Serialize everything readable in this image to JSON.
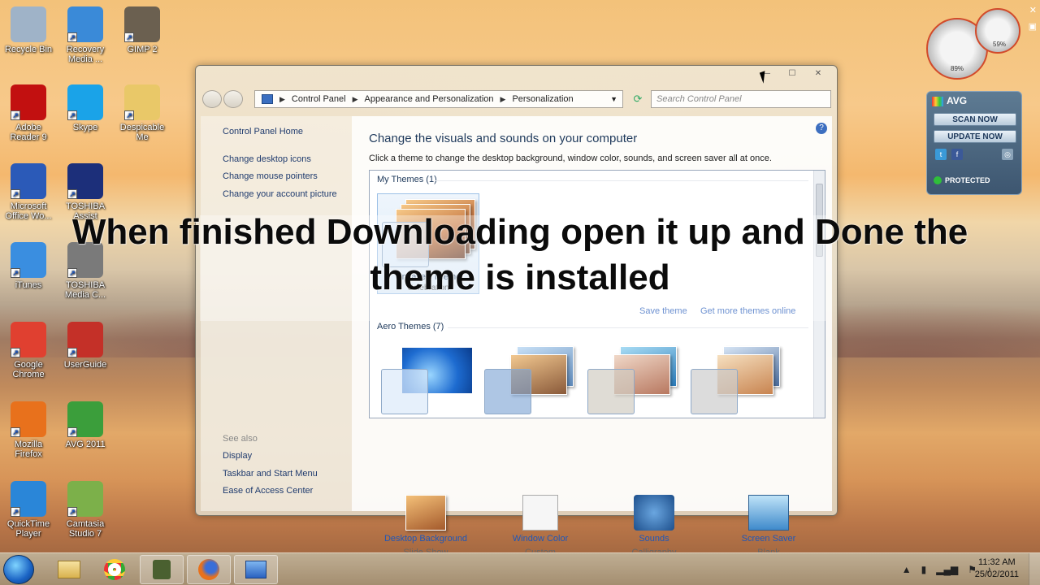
{
  "desktop": {
    "icons": [
      {
        "label": "Recycle Bin",
        "icon": "recycle-bin-icon",
        "color": "#9fb3c8"
      },
      {
        "label": "Recovery Media ...",
        "icon": "recovery-media-icon",
        "color": "#3a8ad8"
      },
      {
        "label": "GIMP 2",
        "icon": "gimp-icon",
        "color": "#6b6050"
      },
      {
        "label": "Adobe Reader 9",
        "icon": "adobe-reader-icon",
        "color": "#c21010"
      },
      {
        "label": "Skype",
        "icon": "skype-icon",
        "color": "#1aa3e8"
      },
      {
        "label": "Despicable Me",
        "icon": "folder-icon",
        "color": "#e9c868"
      },
      {
        "label": "Microsoft Office Wo...",
        "icon": "word-icon",
        "color": "#2b5ab8"
      },
      {
        "label": "TOSHIBA Assist",
        "icon": "toshiba-assist-icon",
        "color": "#1c2f7a"
      },
      {
        "label": "iTunes",
        "icon": "itunes-icon",
        "color": "#3a8ee0"
      },
      {
        "label": "TOSHIBA Media C...",
        "icon": "toshiba-media-icon",
        "color": "#7a7a7a"
      },
      {
        "label": "Google Chrome",
        "icon": "chrome-icon",
        "color": "#e04030"
      },
      {
        "label": "UserGuide",
        "icon": "userguide-icon",
        "color": "#c43028"
      },
      {
        "label": "Mozilla Firefox",
        "icon": "firefox-icon",
        "color": "#e8711c"
      },
      {
        "label": "AVG 2011",
        "icon": "avg-icon",
        "color": "#3b9e3b"
      },
      {
        "label": "QuickTime Player",
        "icon": "quicktime-icon",
        "color": "#2a86d8"
      },
      {
        "label": "Camtasia Studio 7",
        "icon": "camtasia-icon",
        "color": "#7cb04a"
      }
    ]
  },
  "window": {
    "controls": {
      "minimize": "—",
      "maximize": "☐",
      "close": "✕"
    },
    "breadcrumb": [
      "Control Panel",
      "Appearance and Personalization",
      "Personalization"
    ],
    "search_placeholder": "Search Control Panel",
    "sidebar": {
      "home": "Control Panel Home",
      "links": [
        "Change desktop icons",
        "Change mouse pointers",
        "Change your account picture"
      ],
      "see_also_label": "See also",
      "see_also": [
        "Display",
        "Taskbar and Start Menu",
        "Ease of Access Center"
      ]
    },
    "main": {
      "title": "Change the visuals and sounds on your computer",
      "subtitle": "Click a theme to change the desktop background, window color, sounds, and screen saver all at once.",
      "my_themes_label": "My Themes (1)",
      "my_theme_name": "Unsaved Theme",
      "my_theme_sub": "Celebration",
      "save_theme": "Save theme",
      "get_more": "Get more themes online",
      "aero_label": "Aero Themes (7)"
    },
    "bottom": [
      {
        "label": "Desktop Background",
        "sub": "Slide Show",
        "icon": "desktop-background-icon"
      },
      {
        "label": "Window Color",
        "sub": "Custom",
        "icon": "window-color-icon"
      },
      {
        "label": "Sounds",
        "sub": "Calligraphy",
        "icon": "sounds-icon"
      },
      {
        "label": "Screen Saver",
        "sub": "Blank",
        "icon": "screen-saver-icon"
      }
    ]
  },
  "overlay": {
    "line1": "When finished Downloading open it up and Done the",
    "line2": "theme is installed"
  },
  "gadgets": {
    "cpu_percent": "89%",
    "mem_percent": "59%",
    "avg": {
      "brand": "AVG",
      "scan_now": "SCAN NOW",
      "update_now": "UPDATE NOW",
      "status": "PROTECTED"
    }
  },
  "taskbar": {
    "time": "11:32 AM",
    "date": "25/02/2011",
    "pinned": [
      "explorer-icon",
      "chrome-icon",
      "camtasia-recorder-icon",
      "firefox-icon",
      "control-panel-icon"
    ]
  }
}
